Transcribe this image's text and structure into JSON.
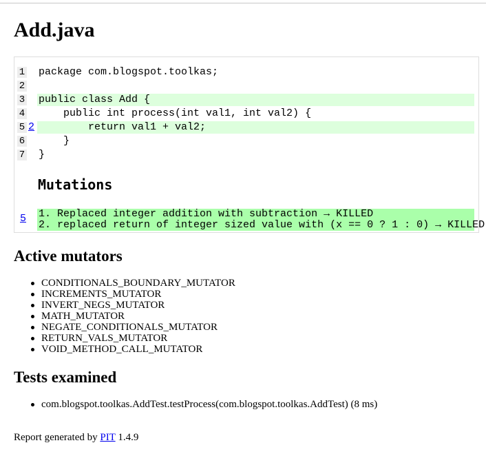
{
  "page": {
    "title": "Add.java"
  },
  "source": {
    "lines": [
      {
        "number": "1",
        "mutations": "",
        "code": "package com.blogspot.toolkas;",
        "status": "none"
      },
      {
        "number": "2",
        "mutations": "",
        "code": "",
        "status": "none"
      },
      {
        "number": "3",
        "mutations": "",
        "code": "public class Add {",
        "status": "covered"
      },
      {
        "number": "4",
        "mutations": "",
        "code": "    public int process(int val1, int val2) {",
        "status": "none"
      },
      {
        "number": "5",
        "mutations": "2",
        "code": "        return val1 + val2;",
        "status": "covered"
      },
      {
        "number": "6",
        "mutations": "",
        "code": "    }",
        "status": "none"
      },
      {
        "number": "7",
        "mutations": "",
        "code": "}",
        "status": "none"
      }
    ]
  },
  "mutations": {
    "title": "Mutations",
    "line_link": "5",
    "items": [
      "1. Replaced integer addition with subtraction → KILLED",
      "2. replaced return of integer sized value with (x == 0 ? 1 : 0) → KILLED"
    ]
  },
  "active_mutators": {
    "title": "Active mutators",
    "items": [
      "CONDITIONALS_BOUNDARY_MUTATOR",
      "INCREMENTS_MUTATOR",
      "INVERT_NEGS_MUTATOR",
      "MATH_MUTATOR",
      "NEGATE_CONDITIONALS_MUTATOR",
      "RETURN_VALS_MUTATOR",
      "VOID_METHOD_CALL_MUTATOR"
    ]
  },
  "tests_examined": {
    "title": "Tests examined",
    "items": [
      "com.blogspot.toolkas.AddTest.testProcess(com.blogspot.toolkas.AddTest) (8 ms)"
    ]
  },
  "footer": {
    "prefix": "Report generated by",
    "link": "PIT",
    "version": "1.4.9"
  }
}
